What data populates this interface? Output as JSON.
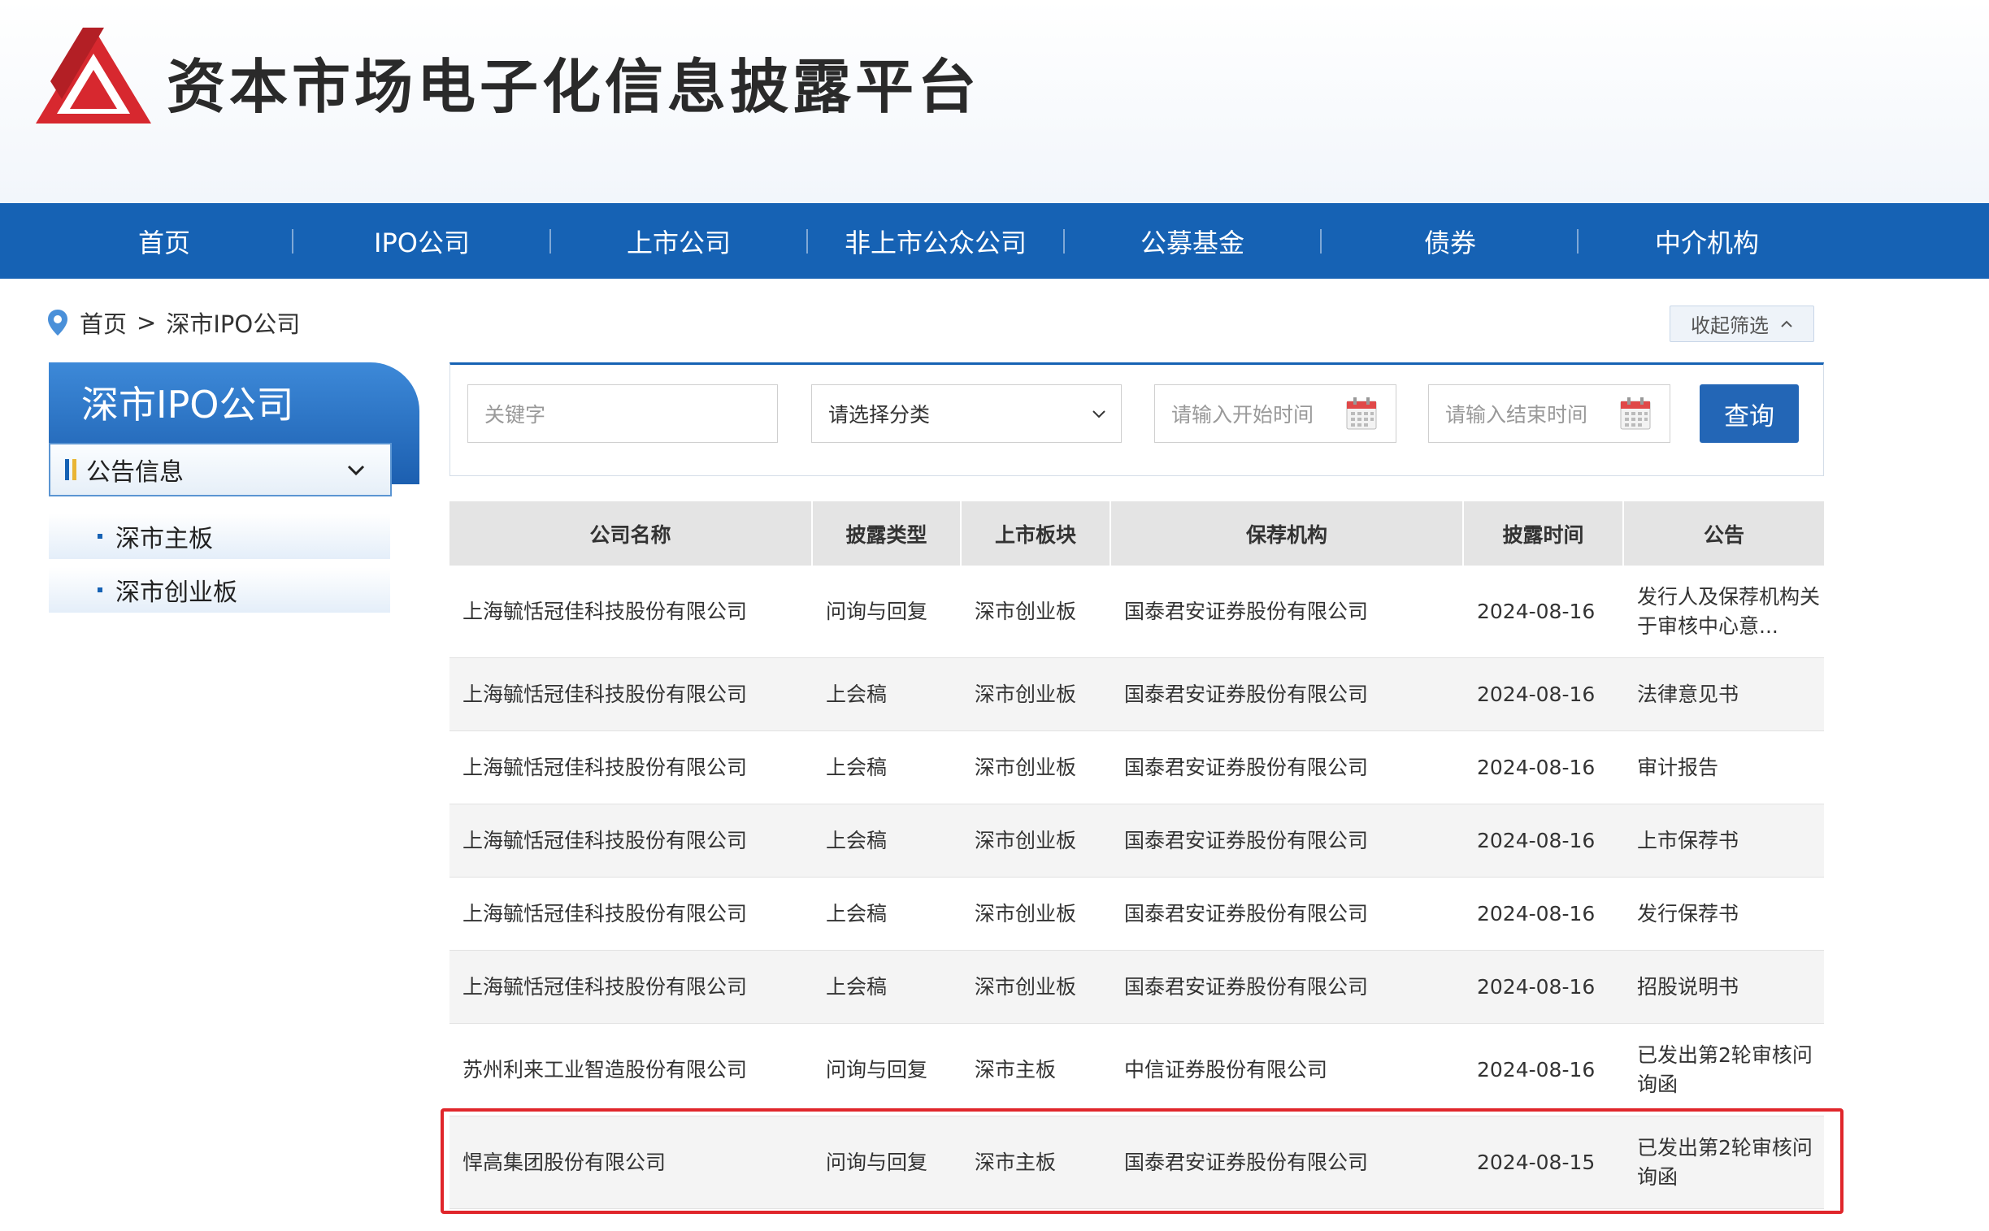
{
  "header": {
    "site_title": "资本市场电子化信息披露平台",
    "brand_color": "#d7282f"
  },
  "nav": {
    "items": [
      "首页",
      "IPO公司",
      "上市公司",
      "非上市公众公司",
      "公募基金",
      "债券",
      "中介机构"
    ],
    "background": "#1662b4"
  },
  "breadcrumb": {
    "icon": "location-pin-icon",
    "home": "首页",
    "separator": ">",
    "current": "深市IPO公司"
  },
  "collapse_filter": {
    "label": "收起筛选",
    "icon": "chevron-up-icon"
  },
  "sidebar": {
    "title": "深市IPO公司",
    "group_label": "公告信息",
    "items": [
      "深市主板",
      "深市创业板"
    ]
  },
  "filter": {
    "keyword_placeholder": "关键字",
    "category_selected": "请选择分类",
    "start_date_placeholder": "请输入开始时间",
    "end_date_placeholder": "请输入结束时间",
    "query_label": "查询"
  },
  "table": {
    "headers": [
      "公司名称",
      "披露类型",
      "上市板块",
      "保荐机构",
      "披露时间",
      "公告"
    ],
    "rows": [
      [
        "上海毓恬冠佳科技股份有限公司",
        "问询与回复",
        "深市创业板",
        "国泰君安证券股份有限公司",
        "2024-08-16",
        "发行人及保荐机构关于审核中心意..."
      ],
      [
        "上海毓恬冠佳科技股份有限公司",
        "上会稿",
        "深市创业板",
        "国泰君安证券股份有限公司",
        "2024-08-16",
        "法律意见书"
      ],
      [
        "上海毓恬冠佳科技股份有限公司",
        "上会稿",
        "深市创业板",
        "国泰君安证券股份有限公司",
        "2024-08-16",
        "审计报告"
      ],
      [
        "上海毓恬冠佳科技股份有限公司",
        "上会稿",
        "深市创业板",
        "国泰君安证券股份有限公司",
        "2024-08-16",
        "上市保荐书"
      ],
      [
        "上海毓恬冠佳科技股份有限公司",
        "上会稿",
        "深市创业板",
        "国泰君安证券股份有限公司",
        "2024-08-16",
        "发行保荐书"
      ],
      [
        "上海毓恬冠佳科技股份有限公司",
        "上会稿",
        "深市创业板",
        "国泰君安证券股份有限公司",
        "2024-08-16",
        "招股说明书"
      ],
      [
        "苏州利来工业智造股份有限公司",
        "问询与回复",
        "深市主板",
        "中信证券股份有限公司",
        "2024-08-16",
        "已发出第2轮审核问询函"
      ],
      [
        "悍高集团股份有限公司",
        "问询与回复",
        "深市主板",
        "国泰君安证券股份有限公司",
        "2024-08-15",
        "已发出第2轮审核问询函"
      ]
    ],
    "highlight_color": "#e0262b"
  }
}
